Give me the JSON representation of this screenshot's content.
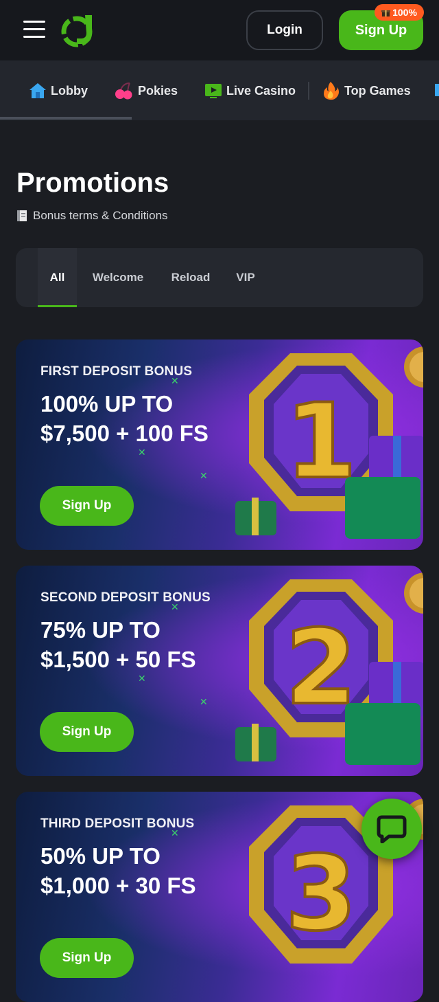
{
  "header": {
    "login_label": "Login",
    "signup_label": "Sign Up",
    "badge_text": "100%",
    "colors": {
      "accent": "#49b71a",
      "badge": "#ff5a1f",
      "header_bg": "#16181d"
    }
  },
  "nav": {
    "items": [
      {
        "label": "Lobby",
        "icon": "home-icon"
      },
      {
        "label": "Pokies",
        "icon": "cherry-icon"
      },
      {
        "label": "Live Casino",
        "icon": "live-tv-icon"
      },
      {
        "label": "Top Games",
        "icon": "flame-icon"
      }
    ]
  },
  "page": {
    "title": "Promotions",
    "terms_link": "Bonus terms & Conditions"
  },
  "tabs": {
    "items": [
      "All",
      "Welcome",
      "Reload",
      "VIP"
    ],
    "active": "All"
  },
  "promos": [
    {
      "subtitle": "FIRST DEPOSIT BONUS",
      "title_line1": "100% UP TO",
      "title_line2": "$7,500 + 100 FS",
      "button": "Sign Up",
      "badge_number": "1"
    },
    {
      "subtitle": "SECOND DEPOSIT BONUS",
      "title_line1": "75% UP TO",
      "title_line2": "$1,500 + 50 FS",
      "button": "Sign Up",
      "badge_number": "2"
    },
    {
      "subtitle": "THIRD DEPOSIT BONUS",
      "title_line1": "50% UP TO",
      "title_line2": "$1,000 + 30 FS",
      "button": "Sign Up",
      "badge_number": "3"
    }
  ],
  "chat": {
    "icon": "chat-bubble-icon"
  }
}
